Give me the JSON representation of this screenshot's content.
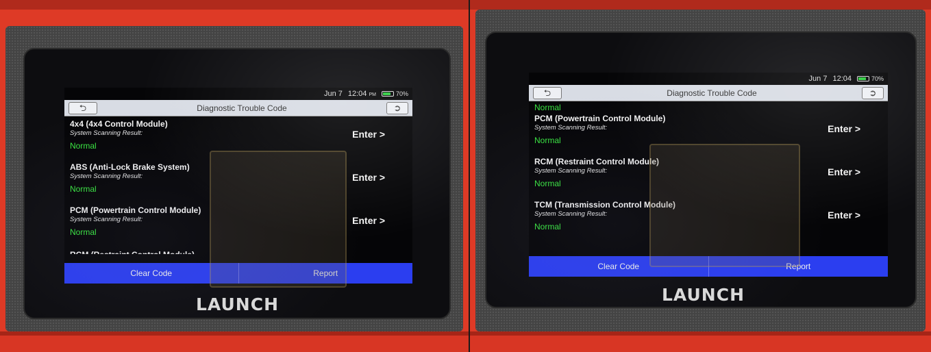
{
  "brand": "LAUNCH",
  "left_screen": {
    "status": {
      "date": "Jun 7",
      "time": "12:04",
      "ampm": "PM",
      "battery": "70%",
      "battery_level": 0.7
    },
    "header": {
      "title": "Diagnostic Trouble Code",
      "back_icon": "back-arrow-icon",
      "exit_icon": "exit-icon"
    },
    "modules": [
      {
        "name": "4x4 (4x4 Control Module)",
        "scan_label": "System Scanning Result:",
        "result": "Normal",
        "action": "Enter >"
      },
      {
        "name": "ABS (Anti-Lock Brake System)",
        "scan_label": "System Scanning Result:",
        "result": "Normal",
        "action": "Enter >"
      },
      {
        "name": "PCM (Powertrain Control Module)",
        "scan_label": "System Scanning Result:",
        "result": "Normal",
        "action": "Enter >"
      }
    ],
    "cut_off_item": "RCM (Restraint Control Module)",
    "footer": {
      "clear_label": "Clear Code",
      "report_label": "Report"
    }
  },
  "right_screen": {
    "status": {
      "date": "Jun 7",
      "time": "12:04",
      "battery": "70%",
      "battery_level": 0.7
    },
    "header": {
      "title": "Diagnostic Trouble Code",
      "back_icon": "back-arrow-icon",
      "exit_icon": "exit-icon"
    },
    "partial_top_result": "Normal",
    "modules": [
      {
        "name": "PCM (Powertrain Control Module)",
        "scan_label": "System Scanning Result:",
        "result": "Normal",
        "action": "Enter >"
      },
      {
        "name": "RCM (Restraint Control Module)",
        "scan_label": "System Scanning Result:",
        "result": "Normal",
        "action": "Enter >"
      },
      {
        "name": "TCM (Transmission Control Module)",
        "scan_label": "System Scanning Result:",
        "result": "Normal",
        "action": "Enter >"
      }
    ],
    "footer": {
      "clear_label": "Clear Code",
      "report_label": "Report"
    }
  },
  "colors": {
    "accent_blue": "#2b3ef0",
    "normal_green": "#39e640",
    "shell_red": "#de3a26"
  }
}
